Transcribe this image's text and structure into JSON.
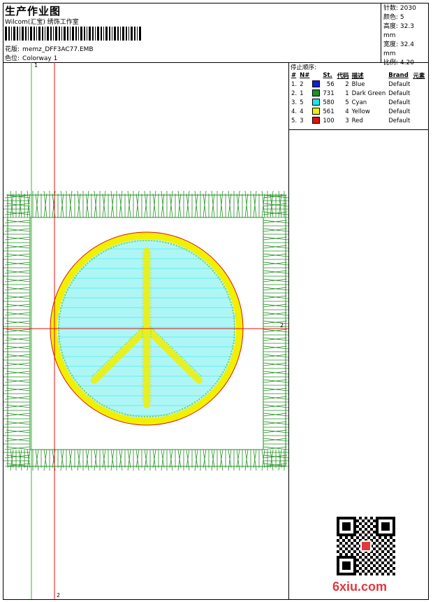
{
  "header": {
    "title": "生产作业图",
    "company": "Wilcom(汇宝) 绣饰工作室",
    "file_label": "花版:",
    "file_name": "memz_DFF3AC77.EMB",
    "color_label": "色位:",
    "colorway": "Colorway 1"
  },
  "stats": {
    "stitches_label": "针数:",
    "stitches": "2030",
    "colors_label": "颜色:",
    "colors": "5",
    "height_label": "高度:",
    "height": "32.3 mm",
    "width_label": "宽度:",
    "width": "32.4 mm",
    "scale_label": "比例:",
    "scale": "4.20"
  },
  "sequence": {
    "title": "停止顺序:",
    "headers": [
      "#",
      "N#",
      "",
      "St.",
      "代码",
      "描述",
      "Brand",
      "元素"
    ],
    "rows": [
      {
        "idx": "1.",
        "n": "2",
        "color": "#1a1adc",
        "st": "56",
        "code": "2",
        "desc": "Blue",
        "brand": "Default"
      },
      {
        "idx": "2.",
        "n": "1",
        "color": "#1f8f1f",
        "st": "731",
        "code": "1",
        "desc": "Dark Green",
        "brand": "Default"
      },
      {
        "idx": "3.",
        "n": "5",
        "color": "#19e6e6",
        "st": "580",
        "code": "5",
        "desc": "Cyan",
        "brand": "Default"
      },
      {
        "idx": "4.",
        "n": "4",
        "color": "#f0f000",
        "st": "561",
        "code": "4",
        "desc": "Yellow",
        "brand": "Default"
      },
      {
        "idx": "5.",
        "n": "3",
        "color": "#e01010",
        "st": "100",
        "code": "3",
        "desc": "Red",
        "brand": "Default"
      }
    ]
  },
  "rulers": {
    "green_label": "1",
    "red_label": "2",
    "cross_label": "2"
  },
  "watermark": "6xiu.com",
  "qr_icon": "qr-code-icon",
  "colors": {
    "green": "#1f8f1f",
    "cyan": "#19e6e6",
    "yellow": "#f0f000",
    "red": "#e01010",
    "blue": "#1a1adc",
    "watermark": "#e0393e"
  }
}
